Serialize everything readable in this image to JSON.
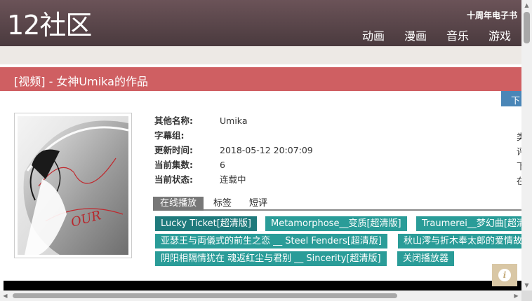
{
  "header": {
    "logo": "12社区",
    "promo": "十周年电子书",
    "nav": [
      "动画",
      "漫画",
      "音乐",
      "游戏"
    ]
  },
  "title": "[视频] - 女神Umika的作品",
  "download_tab": "下",
  "info": {
    "rows": [
      {
        "key": "其他名称:",
        "value": "Umika"
      },
      {
        "key": "字幕组:",
        "value": ""
      },
      {
        "key": "更新时间:",
        "value": "2018-05-12 20:07:09"
      },
      {
        "key": "当前集数:",
        "value": "6"
      },
      {
        "key": "当前状态:",
        "value": "连载中"
      }
    ],
    "side_chars": [
      "类",
      "评",
      "下",
      "在"
    ]
  },
  "tabs": [
    "在线播放",
    "标签",
    "短评"
  ],
  "episodes": [
    "Lucky Ticket[超清版]",
    "Metamorphose__变质[超清版]",
    "Traumerei__梦幻曲[超清",
    "亚瑟王与両儀式的前生之恋 __ Steel Fenders[超清版]",
    "秋山澪与折木奉太郎的爱情故",
    "阴阳相隔情犹在 魂返红尘与君别 __ Sincerity[超清版]",
    "关闭播放器"
  ],
  "cover_text": "OUR",
  "icons": {
    "info": "info-icon",
    "scroll_up": "chevron-up-icon",
    "scroll_down": "chevron-down-icon",
    "scroll_left": "chevron-left-icon",
    "scroll_right": "chevron-right-icon"
  },
  "colors": {
    "header": "#5a474c",
    "title_bar": "#cf5f62",
    "episode_button": "#2a9c98",
    "download_tab": "#4a86b7"
  }
}
